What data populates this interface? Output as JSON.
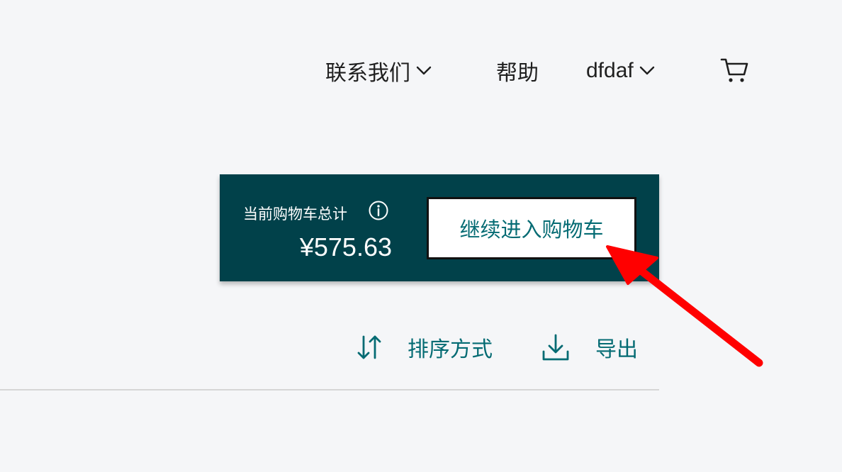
{
  "nav": {
    "contact_label": "联系我们",
    "help_label": "帮助",
    "account_label": "dfdaf",
    "cart_icon": "cart-icon"
  },
  "cart_summary": {
    "total_label": "当前购物车总计",
    "total_amount": "¥575.63",
    "continue_label": "继续进入购物车",
    "info_icon": "info-icon"
  },
  "toolbar": {
    "sort_label": "排序方式",
    "export_label": "导出",
    "sort_icon": "sort-arrows-icon",
    "export_icon": "download-icon"
  },
  "colors": {
    "background": "#f5f6f8",
    "panel": "#01414a",
    "accent": "#046b73",
    "annotation": "#ff0000"
  }
}
